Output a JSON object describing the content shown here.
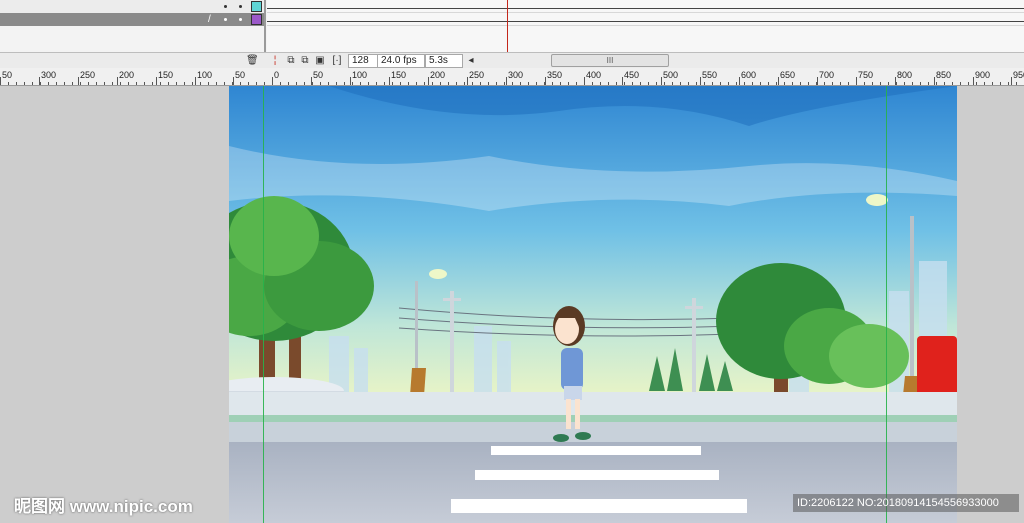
{
  "timeline": {
    "frame_field": "128",
    "fps_field": "24.0 fps",
    "time_field": "5.3s",
    "scroll_glyph": "III",
    "scroll_left": "◂"
  },
  "ruler": {
    "labels": [
      "50",
      "300",
      "250",
      "200",
      "150",
      "100",
      "50",
      "0",
      "50",
      "100",
      "150",
      "200",
      "250",
      "300",
      "350",
      "400",
      "450",
      "500",
      "550",
      "600",
      "650",
      "700",
      "750",
      "800",
      "850",
      "900",
      "950",
      "100"
    ]
  },
  "watermarks": {
    "left": "昵图网 www.nipic.com",
    "right": "ID:2206122 NO:20180914154556933000"
  },
  "colors": {
    "sky_top": "#2f86d2",
    "sky_bottom": "#e8f4c6",
    "guide": "#27b24a",
    "playhead": "#c4271b",
    "mailbox": "#e0221c"
  }
}
